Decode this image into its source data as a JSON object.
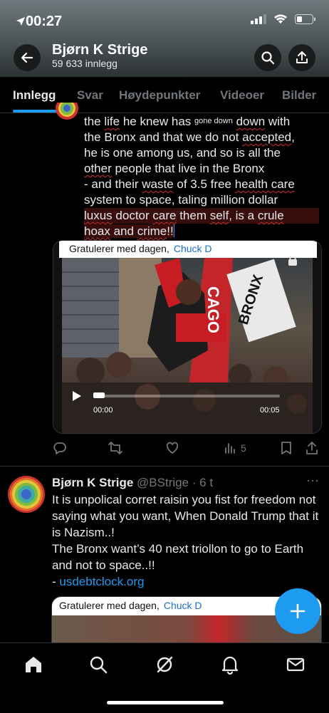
{
  "status": {
    "time": "00:27"
  },
  "header": {
    "name": "Bjørn K Strige",
    "post_count": "59 633 innlegg"
  },
  "tabs": [
    {
      "label": "Innlegg",
      "active": true
    },
    {
      "label": "Svar"
    },
    {
      "label": "Høydepunkter"
    },
    {
      "label": "Videoer"
    },
    {
      "label": "Bilder"
    }
  ],
  "tweet1": {
    "lines": {
      "l1a": "the ",
      "l1b": "life",
      "l1c": " he knew has ",
      "l1d": "gone down",
      "l1e": " ",
      "l1f": "down",
      "l1g": " with",
      "l2a": "the Bronx and that we do not ",
      "l2b": "accepted",
      "l3": "he is one among us, and so is all the",
      "l4a": "other",
      "l4b": " people that live in the Bronx",
      "l5a": "- and their ",
      "l5b": "waste",
      "l5c": " of 3.5 free ",
      "l5d": "health care",
      "l6": "system to space, taling million dollar",
      "l7a": "luxus",
      "l7b": " doctor ",
      "l7c": "care",
      "l7d": " them ",
      "l7e": "self",
      "l7f": ", is a ",
      "l7g": "crule",
      "l8a": "hoax",
      "l8b": " and ",
      "l8c": "crime",
      "l8d": "!!"
    },
    "media": {
      "congrats": "Gratulerer med dagen,",
      "user": "Chuck D",
      "time_start": "00:00",
      "time_end": "00:05",
      "sign": "BRONX",
      "banner": "CAGO"
    },
    "views": "5"
  },
  "tweet2": {
    "name": "Bjørn K Strige",
    "handle": "@BStrige · 6 t",
    "more": "···",
    "body": {
      "p1": "It is unpolical corret raisin you fist for freedom not saying what you want, When Donald Trump that it is Nazism..!",
      "p2": "The Bronx want’s 40 next triollon to go to Earth and not to space..!!",
      "p3_prefix": "- ",
      "link": "usdebtclock.org"
    },
    "media": {
      "congrats": "Gratulerer med dagen,",
      "user": "Chuck D"
    }
  },
  "colors": {
    "accent": "#1d9bf0",
    "squiggle": "#d0312d"
  },
  "icons": [
    "back-arrow-icon",
    "search-icon",
    "share-icon",
    "reply-icon",
    "retweet-icon",
    "like-icon",
    "views-icon",
    "bookmark-icon",
    "home-icon",
    "explore-icon",
    "grok-icon",
    "notifications-icon",
    "messages-icon",
    "compose-plus-icon"
  ]
}
